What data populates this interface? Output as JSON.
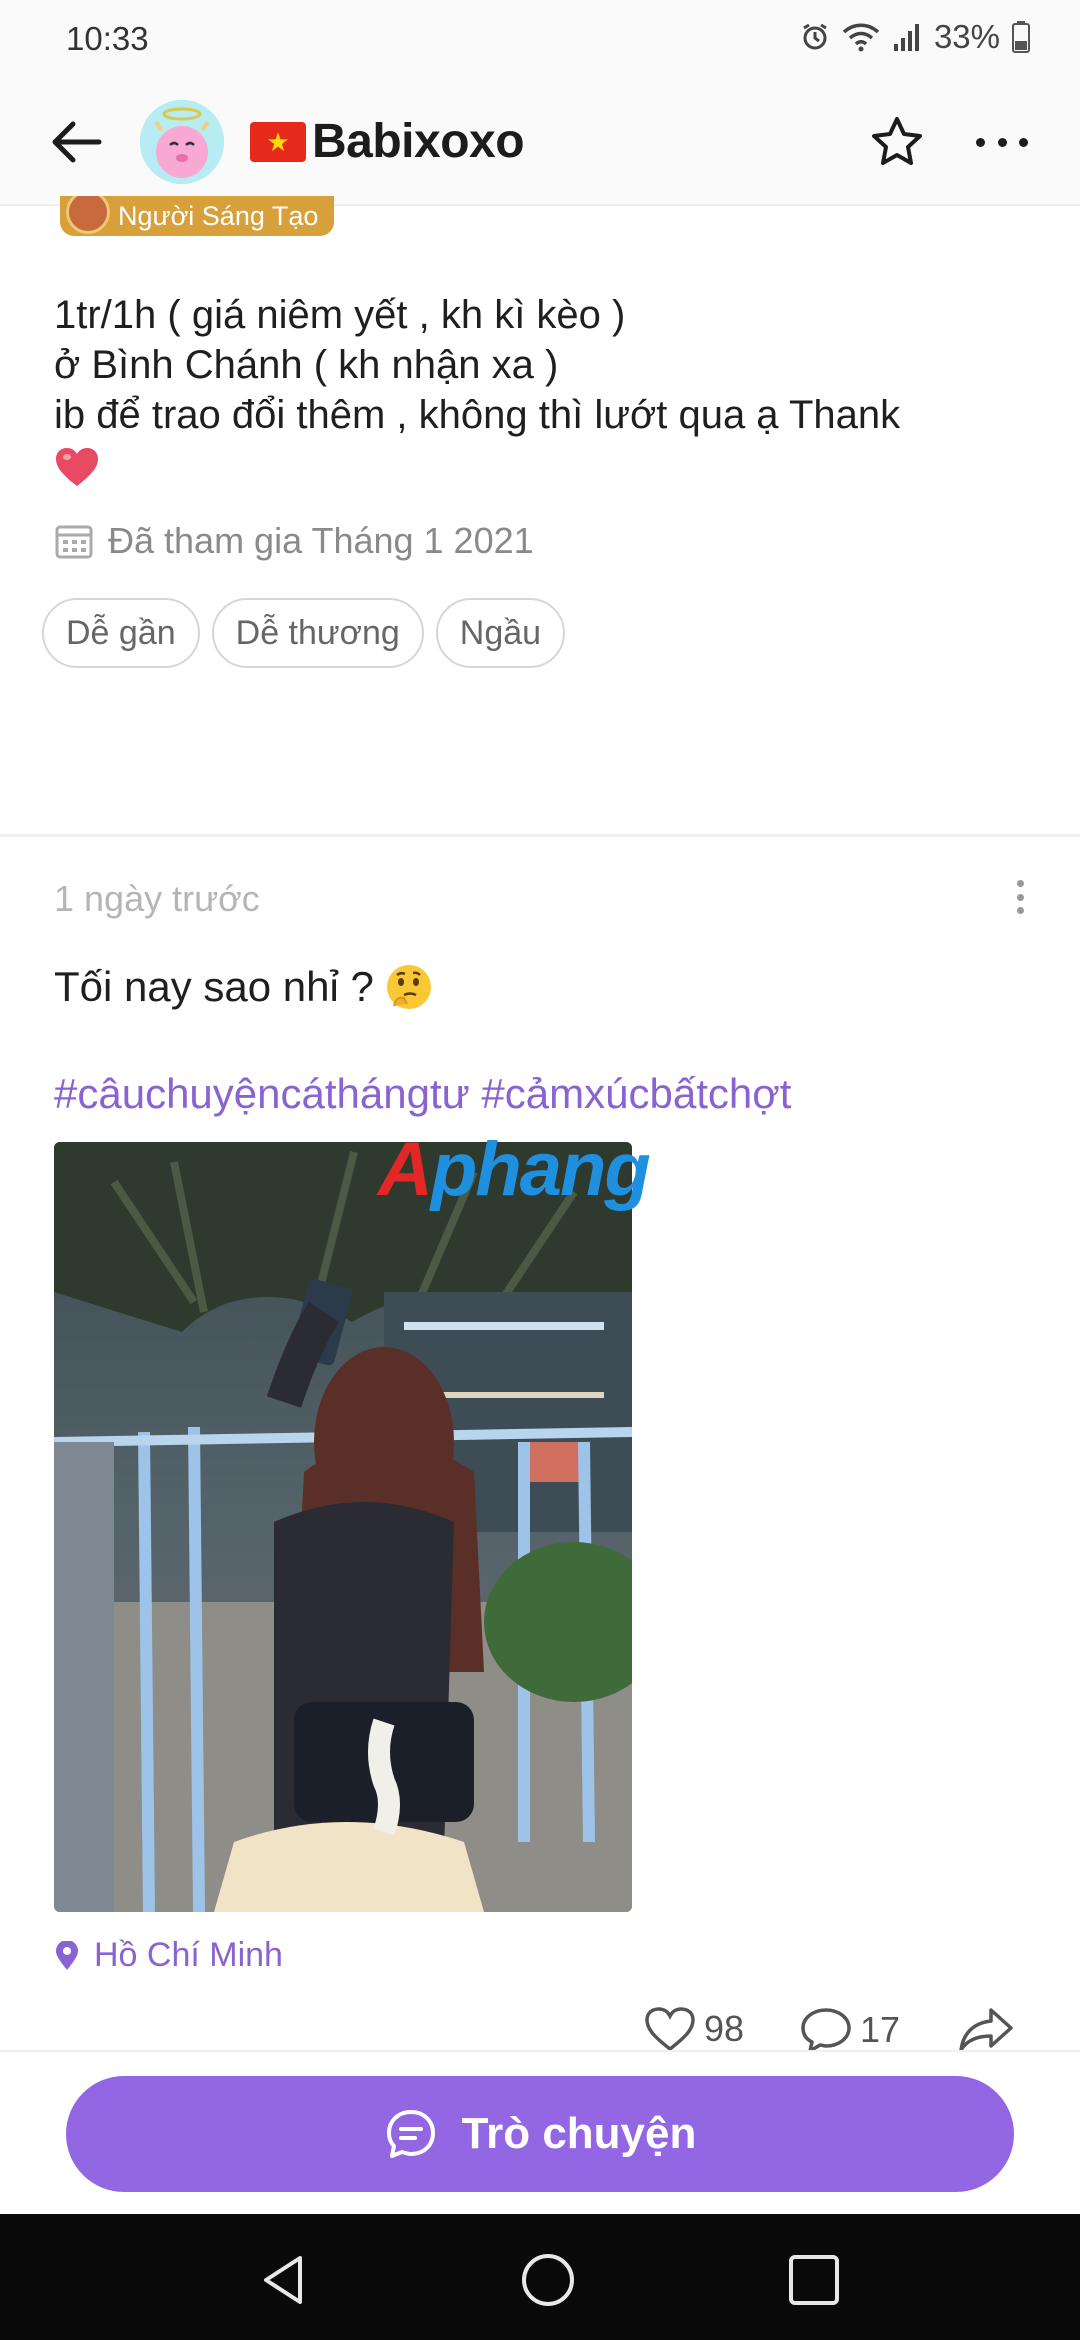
{
  "status_bar": {
    "time": "10:33",
    "battery": "33%"
  },
  "header": {
    "username": "Babixoxo",
    "back_icon": "arrow-left-icon",
    "favorite_icon": "star-icon",
    "more_icon": "more-horizontal-icon"
  },
  "profile": {
    "badge": "Người Sáng Tạo",
    "bio_lines": [
      "1tr/1h ( giá niêm yết , kh kì kèo )",
      "ở Bình Chánh ( kh nhận xa )",
      "ib để trao đổi thêm , không thì lướt qua ạ Thank"
    ],
    "joined": "Đã tham gia Tháng 1 2021",
    "tags": [
      "Dễ gần",
      "Dễ thương",
      "Ngầu"
    ]
  },
  "post": {
    "time": "1 ngày trước",
    "text": "Tối nay sao nhỉ ?",
    "hashtags": "#câuchuyệncáthángtư #cảmxúcbấtchợt",
    "watermark_part1": "A",
    "watermark_part2": "phang",
    "location": "Hồ Chí Minh",
    "likes": "98",
    "comments": "17"
  },
  "chat_button": {
    "label": "Trò chuyện"
  },
  "colors": {
    "accent": "#9366e3",
    "hashtag": "#8a63d2"
  }
}
